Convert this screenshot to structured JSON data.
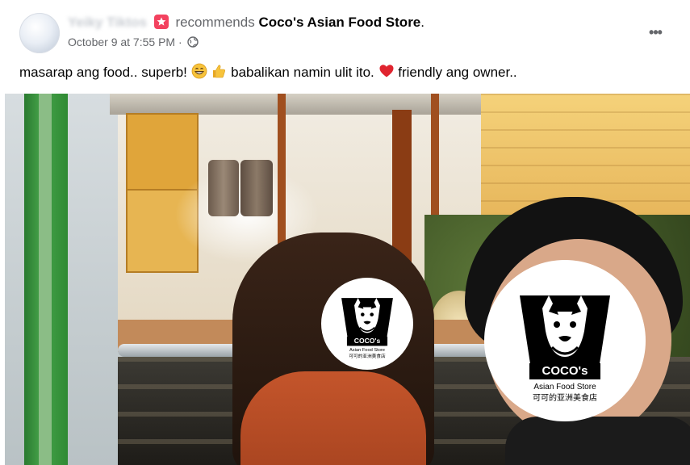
{
  "post": {
    "author_name": "Yeiky Tiktos",
    "recommends_text": "recommends",
    "store_name": "Coco's Asian Food Store",
    "period": ".",
    "timestamp": "October 9 at 7:55 PM",
    "separator": "·",
    "more_label": "•••",
    "message": {
      "part1": "masarap ang food.. superb! ",
      "emoji1": "grinning-face",
      "emoji2": "thumbs-up",
      "part2": " babalikan namin ulit ito. ",
      "emoji3": "red-heart",
      "part3": " friendly ang owner.."
    }
  },
  "photo": {
    "logo": {
      "title": "COCO's",
      "subtitle": "Asian Food Store",
      "chinese": "可可的亚洲美食店"
    }
  },
  "colors": {
    "recommend_badge": "#f3425f",
    "meta_gray": "#65676b",
    "text": "#050505"
  }
}
